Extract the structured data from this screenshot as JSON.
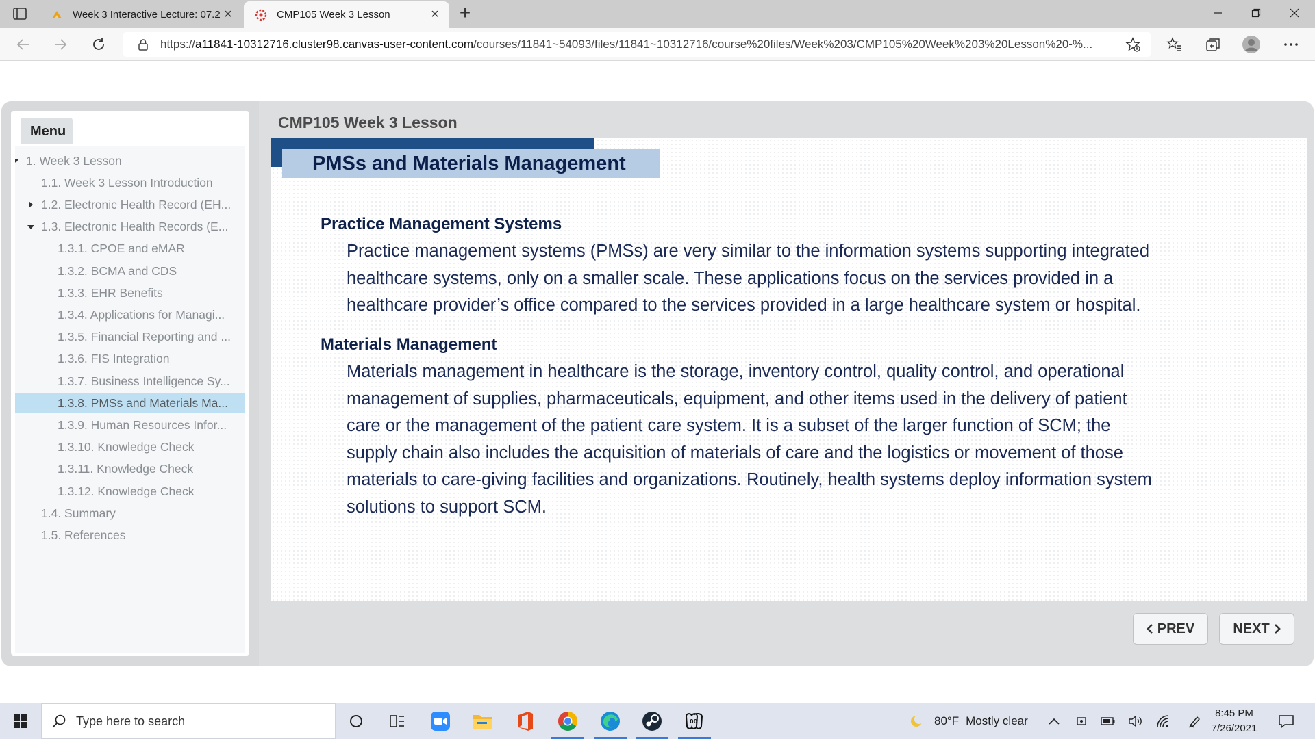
{
  "browser": {
    "tabs": [
      {
        "title": "Week 3 Interactive Lecture: 07.2’",
        "active": false
      },
      {
        "title": "CMP105 Week 3 Lesson",
        "active": true
      }
    ],
    "url_prefix": "https://",
    "url_host": "a11841-10312716.cluster98.canvas-user-content.com",
    "url_path": "/courses/11841~54093/files/11841~10312716/course%20files/Week%203/CMP105%20Week%203%20Lesson%20-%...",
    "icons": [
      "sidebar-tabs-icon",
      "back-icon",
      "forward-icon",
      "refresh-icon",
      "lock-icon",
      "add-favorite-icon",
      "favorites-icon",
      "collections-icon",
      "profile-icon",
      "more-icon",
      "minimize-icon",
      "restore-icon",
      "close-icon"
    ]
  },
  "course": {
    "menu_label": "Menu",
    "lesson_title": "CMP105 Week 3 Lesson",
    "menu_items": [
      {
        "label": "1. Week 3 Lesson",
        "level": 0,
        "arrow": "down"
      },
      {
        "label": "1.1. Week 3 Lesson Introduction",
        "level": 1,
        "arrow": ""
      },
      {
        "label": "1.2. Electronic Health Record (EH...",
        "level": 1,
        "arrow": "right"
      },
      {
        "label": "1.3. Electronic Health Records (E...",
        "level": 1,
        "arrow": "down"
      },
      {
        "label": "1.3.1. CPOE and eMAR",
        "level": 2,
        "arrow": ""
      },
      {
        "label": "1.3.2. BCMA and CDS",
        "level": 2,
        "arrow": ""
      },
      {
        "label": "1.3.3. EHR Benefits",
        "level": 2,
        "arrow": ""
      },
      {
        "label": "1.3.4. Applications for Managi...",
        "level": 2,
        "arrow": ""
      },
      {
        "label": "1.3.5. Financial Reporting and ...",
        "level": 2,
        "arrow": ""
      },
      {
        "label": "1.3.6. FIS Integration",
        "level": 2,
        "arrow": ""
      },
      {
        "label": "1.3.7. Business Intelligence Sy...",
        "level": 2,
        "arrow": ""
      },
      {
        "label": "1.3.8. PMSs and Materials Ma...",
        "level": 2,
        "arrow": "",
        "selected": true
      },
      {
        "label": "1.3.9. Human Resources Infor...",
        "level": 2,
        "arrow": ""
      },
      {
        "label": "1.3.10. Knowledge Check",
        "level": 2,
        "arrow": ""
      },
      {
        "label": "1.3.11. Knowledge Check",
        "level": 2,
        "arrow": ""
      },
      {
        "label": "1.3.12. Knowledge Check",
        "level": 2,
        "arrow": ""
      },
      {
        "label": "1.4. Summary",
        "level": 1,
        "arrow": ""
      },
      {
        "label": "1.5. References",
        "level": 1,
        "arrow": ""
      }
    ],
    "slide": {
      "heading": "PMSs and Materials Management",
      "sections": [
        {
          "title": "Practice Management Systems",
          "lines": [
            "Practice management systems (PMSs) are very similar to the information systems supporting integrated",
            "healthcare systems, only on a smaller scale. These applications focus on the services provided in a",
            "healthcare provider’s office compared to the services provided in a large healthcare system or hospital."
          ]
        },
        {
          "title": "Materials Management",
          "lines": [
            "Materials management in healthcare is the storage, inventory control, quality control, and operational",
            "management of supplies, pharmaceuticals, equipment, and other items used in the delivery of patient",
            "care or the management of the patient care system. It is a subset of the larger function of SCM; the",
            "supply chain also includes the acquisition of materials of care and the logistics or movement of those",
            "materials to care-giving facilities and organizations. Routinely, health systems deploy information system",
            "solutions to support SCM."
          ]
        }
      ]
    },
    "prev_label": "PREV",
    "next_label": "NEXT"
  },
  "taskbar": {
    "search_placeholder": "Type here to search",
    "apps": [
      "cortana-icon",
      "task-view-icon",
      "zoom-icon",
      "file-explorer-icon",
      "office-icon",
      "chrome-icon",
      "edge-icon",
      "steam-icon",
      "game-icon"
    ],
    "weather_temp": "80°F",
    "weather_text": "Mostly clear",
    "time": "8:45 PM",
    "date": "7/26/2021"
  },
  "colors": {
    "accent_dark": "#1e4f86",
    "accent_light": "#b6cbe4",
    "selected_item": "#bfe0f2",
    "text_navy": "#1a2a55"
  }
}
